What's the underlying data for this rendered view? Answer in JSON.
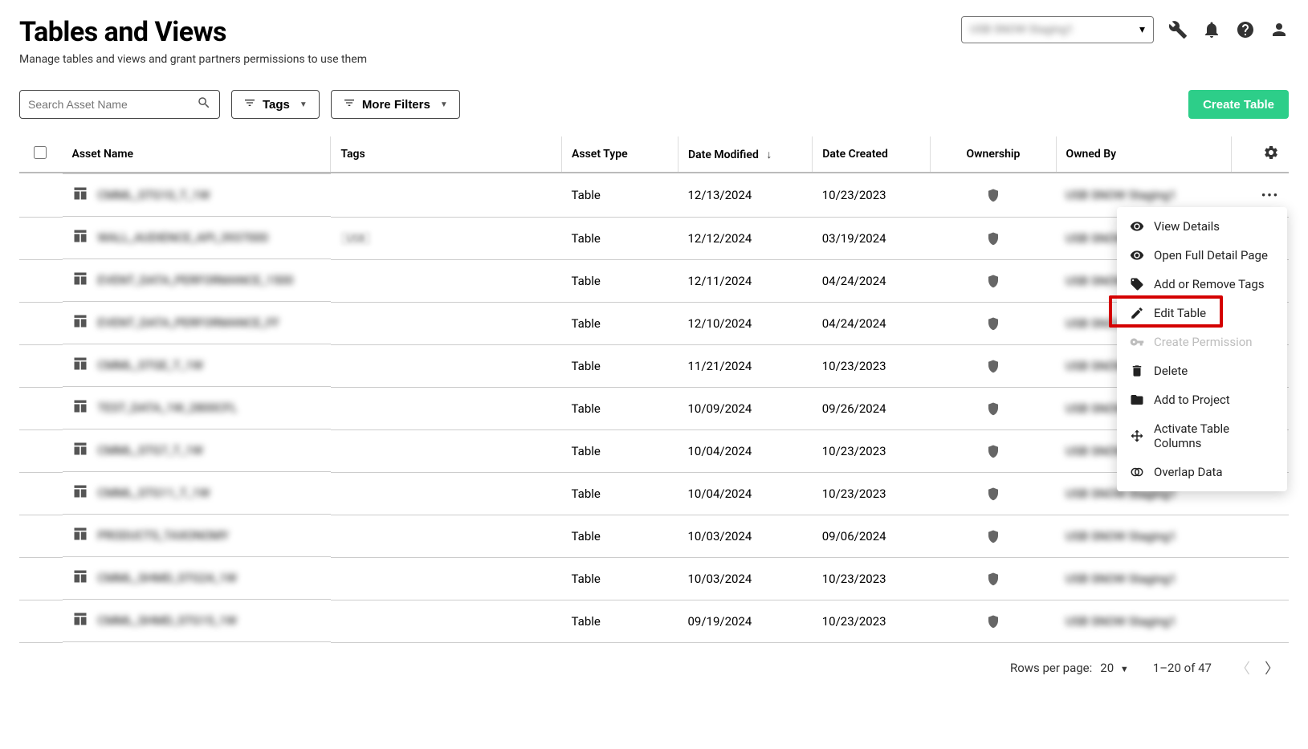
{
  "header": {
    "title": "Tables and Views",
    "subtitle": "Manage tables and views and grant partners permissions to use them",
    "env_label": "USB SNOW Staging1"
  },
  "toolbar": {
    "search_placeholder": "Search Asset Name",
    "tags_label": "Tags",
    "more_filters_label": "More Filters",
    "create_label": "Create Table"
  },
  "columns": {
    "name": "Asset Name",
    "tags": "Tags",
    "type": "Asset Type",
    "modified": "Date Modified",
    "created": "Date Created",
    "ownership": "Ownership",
    "owned_by": "Owned By"
  },
  "rows": [
    {
      "name": "CMML_STG10_T_1W",
      "tag": "",
      "type": "Table",
      "modified": "12/13/2024",
      "created": "10/23/2023",
      "owned": "USB SNOW Staging1",
      "actions": true
    },
    {
      "name": "WALL_AUDIENCE_API_3937000",
      "tag": "USB",
      "type": "Table",
      "modified": "12/12/2024",
      "created": "03/19/2024",
      "owned": "USB SNOW Staging1"
    },
    {
      "name": "EVENT_DATA_PERFORMANCE_1500",
      "tag": "",
      "type": "Table",
      "modified": "12/11/2024",
      "created": "04/24/2024",
      "owned": "USB SNOW Staging1"
    },
    {
      "name": "EVENT_DATA_PERFORMANCE_FF",
      "tag": "",
      "type": "Table",
      "modified": "12/10/2024",
      "created": "04/24/2024",
      "owned": "USB SNOW Staging1"
    },
    {
      "name": "CMML_STGE_T_1W",
      "tag": "",
      "type": "Table",
      "modified": "11/21/2024",
      "created": "10/23/2023",
      "owned": "USB SNOW Staging1"
    },
    {
      "name": "TEST_DATA_1W_2800CFL",
      "tag": "",
      "type": "Table",
      "modified": "10/09/2024",
      "created": "09/26/2024",
      "owned": "USB SNOW Staging1"
    },
    {
      "name": "CMML_STG7_T_1W",
      "tag": "",
      "type": "Table",
      "modified": "10/04/2024",
      "created": "10/23/2023",
      "owned": "USB SNOW Staging1"
    },
    {
      "name": "CMML_STG11_T_1W",
      "tag": "",
      "type": "Table",
      "modified": "10/04/2024",
      "created": "10/23/2023",
      "owned": "USB SNOW Staging1"
    },
    {
      "name": "PRODUCTS_TAXONOMY",
      "tag": "",
      "type": "Table",
      "modified": "10/03/2024",
      "created": "09/06/2024",
      "owned": "USB SNOW Staging1"
    },
    {
      "name": "CMML_SHMD_STG24_1W",
      "tag": "",
      "type": "Table",
      "modified": "10/03/2024",
      "created": "10/23/2023",
      "owned": "USB SNOW Staging1"
    },
    {
      "name": "CMML_SHMD_STG15_1W",
      "tag": "",
      "type": "Table",
      "modified": "09/19/2024",
      "created": "10/23/2023",
      "owned": "USB SNOW Staging1"
    }
  ],
  "menu": {
    "view_details": "View Details",
    "open_full": "Open Full Detail Page",
    "add_remove_tags": "Add or Remove Tags",
    "edit_table": "Edit Table",
    "create_permission": "Create Permission",
    "delete": "Delete",
    "add_to_project": "Add to Project",
    "activate_cols": "Activate Table Columns",
    "overlap_data": "Overlap Data"
  },
  "pager": {
    "rows_label": "Rows per page:",
    "rows_value": "20",
    "range": "1–20 of 47"
  }
}
